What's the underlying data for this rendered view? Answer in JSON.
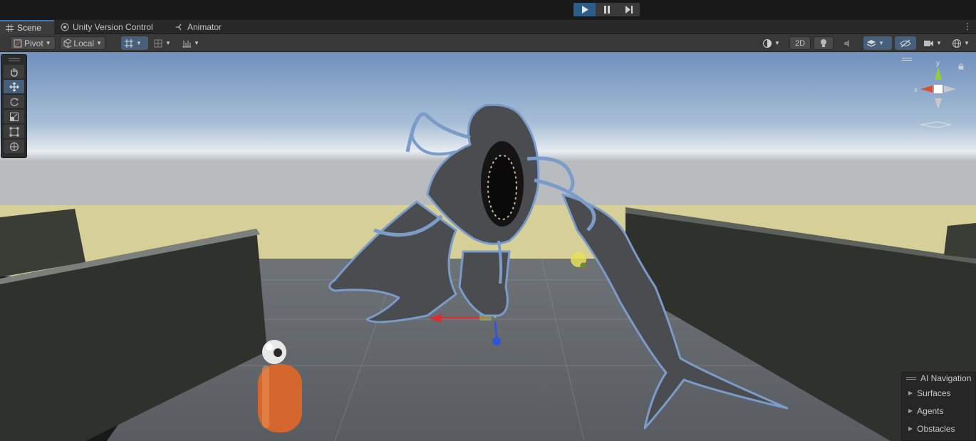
{
  "playmode": {
    "play_icon": "play-icon",
    "pause_icon": "pause-icon",
    "step_icon": "step-icon",
    "accent": "#2c5d87"
  },
  "tabs": [
    {
      "label": "Scene",
      "icon": "grid-icon",
      "active": true
    },
    {
      "label": "Unity Version Control",
      "icon": "version-control-icon",
      "active": false
    },
    {
      "label": "Animator",
      "icon": "animator-icon",
      "active": false
    }
  ],
  "toolbar": {
    "pivot_label": "Pivot",
    "local_label": "Local",
    "view_2d_label": "2D"
  },
  "tools": [
    {
      "name": "hand-tool",
      "active": false
    },
    {
      "name": "move-tool",
      "active": true
    },
    {
      "name": "rotate-tool",
      "active": false
    },
    {
      "name": "scale-tool",
      "active": false
    },
    {
      "name": "rect-tool",
      "active": false
    },
    {
      "name": "transform-tool",
      "active": false
    }
  ],
  "gizmo": {
    "x_label": "x",
    "y_label": "y",
    "x_color": "#d9502f",
    "y_color": "#8ed13a",
    "z_color": "#3a6fd9"
  },
  "ai_navigation": {
    "title": "AI Navigation",
    "items": [
      "Surfaces",
      "Agents",
      "Obstacles"
    ]
  }
}
